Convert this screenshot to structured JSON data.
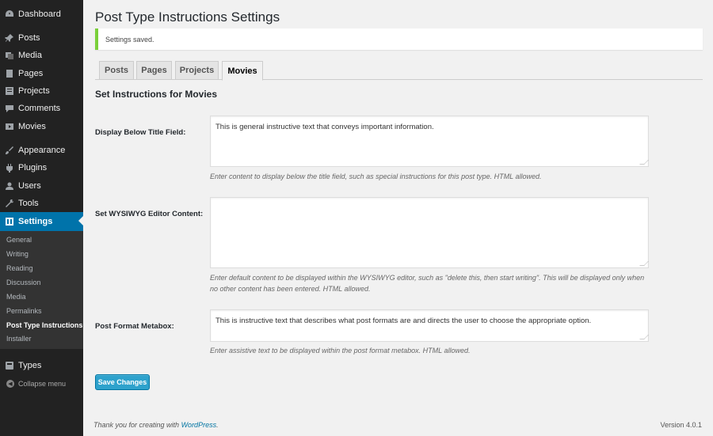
{
  "sidebar": {
    "items": [
      {
        "label": "Dashboard",
        "icon": "dashboard-icon"
      },
      {
        "label": "Posts",
        "icon": "pin-icon"
      },
      {
        "label": "Media",
        "icon": "media-icon"
      },
      {
        "label": "Pages",
        "icon": "pages-icon"
      },
      {
        "label": "Projects",
        "icon": "projects-icon"
      },
      {
        "label": "Comments",
        "icon": "comments-icon"
      },
      {
        "label": "Movies",
        "icon": "movies-icon"
      },
      {
        "label": "Appearance",
        "icon": "appearance-icon"
      },
      {
        "label": "Plugins",
        "icon": "plugins-icon"
      },
      {
        "label": "Users",
        "icon": "users-icon"
      },
      {
        "label": "Tools",
        "icon": "tools-icon"
      },
      {
        "label": "Settings",
        "icon": "settings-icon"
      },
      {
        "label": "Types",
        "icon": "types-icon"
      }
    ],
    "submenu": [
      "General",
      "Writing",
      "Reading",
      "Discussion",
      "Media",
      "Permalinks",
      "Post Type Instructions",
      "Installer"
    ],
    "collapse_label": "Collapse menu"
  },
  "page": {
    "title": "Post Type Instructions Settings",
    "notice": "Settings saved.",
    "tabs": [
      "Posts",
      "Pages",
      "Projects",
      "Movies"
    ],
    "active_tab": "Movies",
    "section_title": "Set Instructions for Movies"
  },
  "fields": {
    "title_field": {
      "label": "Display Below Title Field:",
      "value": "This is general instructive text that conveys important information.",
      "description": "Enter content to display below the title field, such as special instructions for this post type. HTML allowed."
    },
    "editor_field": {
      "label": "Set WYSIWYG Editor Content:",
      "value": "",
      "description": "Enter default content to be displayed within the WYSIWYG editor, such as \"delete this, then start writing\". This will be displayed only when no other content has been entered. HTML allowed."
    },
    "format_field": {
      "label": "Post Format Metabox:",
      "value": "This is instructive text that describes what post formats are and directs the user to choose the appropriate option.",
      "description": "Enter assistive text to be displayed within the post format metabox. HTML allowed."
    }
  },
  "save_label": "Save Changes",
  "footer": {
    "thanks_prefix": "Thank you for creating with ",
    "thanks_link": "WordPress",
    "thanks_suffix": ".",
    "version": "Version 4.0.1"
  },
  "colors": {
    "sidebar": "#222222",
    "accent": "#0073aa",
    "notice_border": "#7ad03a",
    "button": "#2ea2cc"
  }
}
